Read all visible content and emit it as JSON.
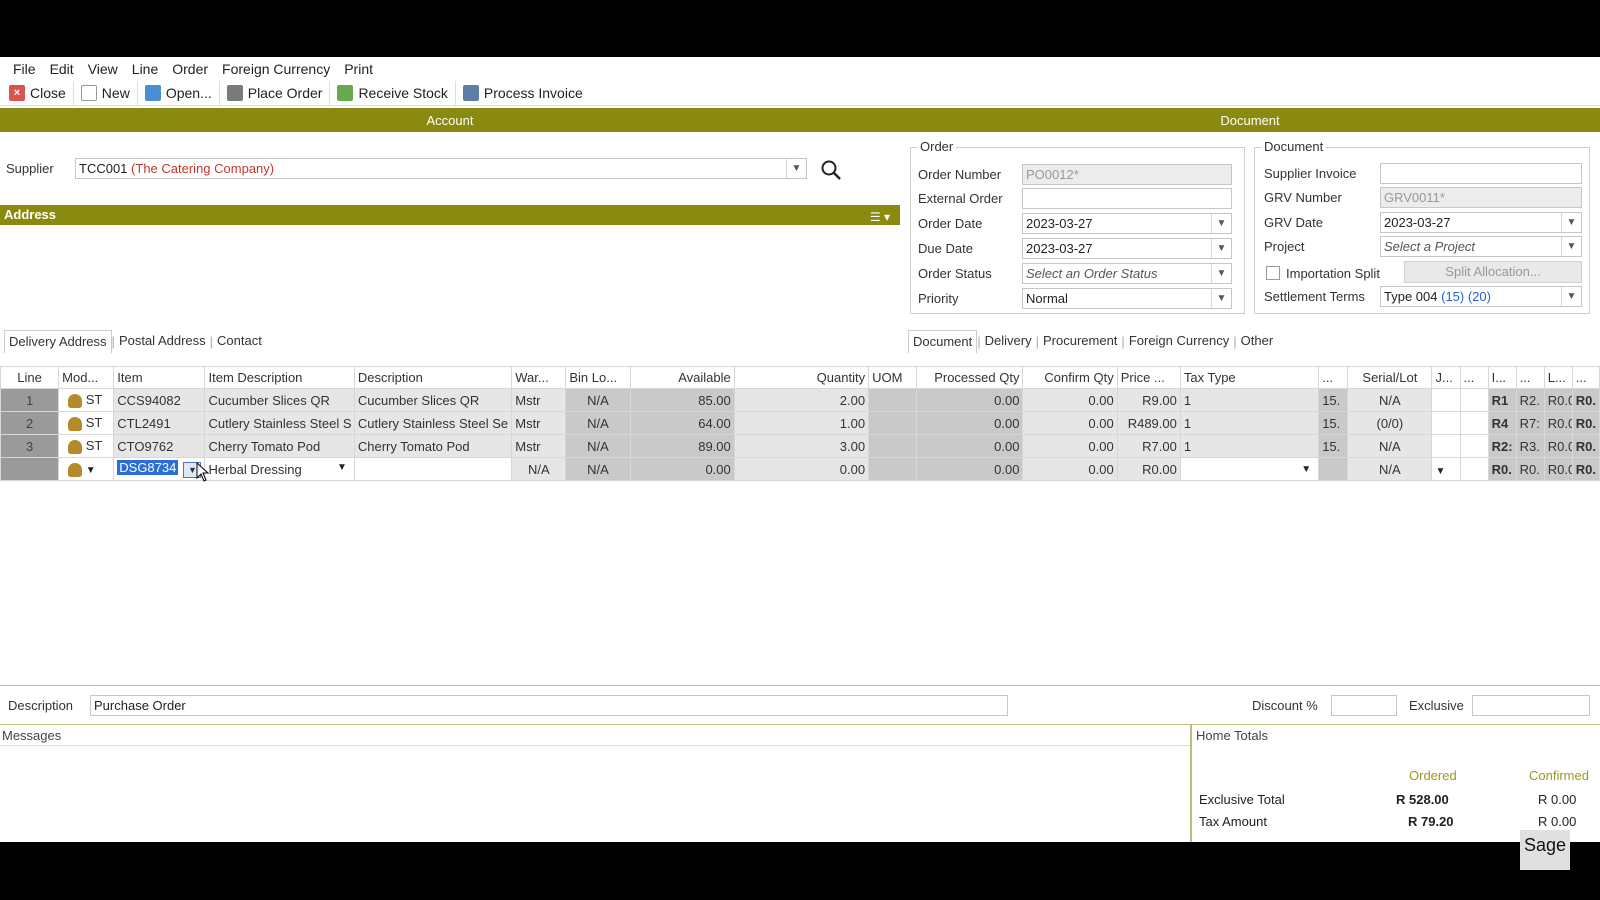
{
  "menu": [
    "File",
    "Edit",
    "View",
    "Line",
    "Order",
    "Foreign Currency",
    "Print"
  ],
  "toolbar": {
    "close": "Close",
    "new": "New",
    "open": "Open...",
    "place_order": "Place Order",
    "receive_stock": "Receive Stock",
    "process_invoice": "Process Invoice"
  },
  "sections": {
    "account": "Account",
    "document": "Document"
  },
  "supplier": {
    "label": "Supplier",
    "code": "TCC001",
    "name": "(The Catering Company)"
  },
  "address": {
    "title": "Address",
    "tabs": [
      "Delivery Address",
      "Postal Address",
      "Contact"
    ]
  },
  "order": {
    "title": "Order",
    "order_number_label": "Order Number",
    "order_number": "PO0012*",
    "external_order_label": "External Order",
    "external_order": "",
    "order_date_label": "Order Date",
    "order_date": "2023-03-27",
    "due_date_label": "Due Date",
    "due_date": "2023-03-27",
    "order_status_label": "Order Status",
    "order_status_placeholder": "Select an Order Status",
    "priority_label": "Priority",
    "priority": "Normal"
  },
  "document": {
    "title": "Document",
    "supplier_invoice_label": "Supplier Invoice",
    "supplier_invoice": "",
    "grv_number_label": "GRV Number",
    "grv_number": "GRV0011*",
    "grv_date_label": "GRV Date",
    "grv_date": "2023-03-27",
    "project_label": "Project",
    "project_placeholder": "Select a Project",
    "importation_split_label": "Importation Split",
    "split_allocation_label": "Split Allocation...",
    "settlement_terms_label": "Settlement Terms",
    "settlement_type": "Type 004",
    "settlement_days": "(15) (20)"
  },
  "doc_tabs": [
    "Document",
    "Delivery",
    "Procurement",
    "Foreign Currency",
    "Other"
  ],
  "grid": {
    "columns": [
      "Line",
      "Mod...",
      "Item",
      "Item Description",
      "Description",
      "War...",
      "Bin Lo...",
      "Available",
      "Quantity",
      "UOM",
      "Processed Qty",
      "Confirm Qty",
      "Price ...",
      "Tax Type",
      "...",
      "Serial/Lot",
      "J...",
      "...",
      "I...",
      "...",
      "L...",
      "..."
    ],
    "rows": [
      {
        "line": "1",
        "mod": "ST",
        "item": "CCS94082",
        "item_desc": "Cucumber Slices QR",
        "desc": "Cucumber Slices QR",
        "war": "Mstr",
        "bin": "N/A",
        "available": "85.00",
        "quantity": "2.00",
        "uom": "",
        "processed": "0.00",
        "confirm": "0.00",
        "price": "R9.00",
        "tax": "1",
        "c15": "15.",
        "serial": "N/A",
        "j": "",
        "d2": "",
        "i": "R1",
        "d3": "R2.",
        "l": "R0.0",
        "d4": "R0."
      },
      {
        "line": "2",
        "mod": "ST",
        "item": "CTL2491",
        "item_desc": "Cutlery Stainless Steel S",
        "desc": "Cutlery Stainless Steel Se",
        "war": "Mstr",
        "bin": "N/A",
        "available": "64.00",
        "quantity": "1.00",
        "uom": "",
        "processed": "0.00",
        "confirm": "0.00",
        "price": "R489.00",
        "tax": "1",
        "c15": "15.",
        "serial": "(0/0)",
        "j": "",
        "d2": "",
        "i": "R4",
        "d3": "R7:",
        "l": "R0.0",
        "d4": "R0."
      },
      {
        "line": "3",
        "mod": "ST",
        "item": "CTO9762",
        "item_desc": "Cherry Tomato Pod",
        "desc": "Cherry Tomato Pod",
        "war": "Mstr",
        "bin": "N/A",
        "available": "89.00",
        "quantity": "3.00",
        "uom": "",
        "processed": "0.00",
        "confirm": "0.00",
        "price": "R7.00",
        "tax": "1",
        "c15": "15.",
        "serial": "N/A",
        "j": "",
        "d2": "",
        "i": "R2:",
        "d3": "R3.",
        "l": "R0.0",
        "d4": "R0."
      }
    ],
    "edit_row": {
      "item": "DSG8734",
      "item_desc": "Herbal Dressing",
      "war": "N/A",
      "bin": "N/A",
      "available": "0.00",
      "quantity": "0.00",
      "processed": "0.00",
      "confirm": "0.00",
      "price": "R0.00",
      "serial": "N/A",
      "i": "R0.",
      "d3": "R0.",
      "l": "R0.0",
      "d4": "R0."
    }
  },
  "footer": {
    "description_label": "Description",
    "description": "Purchase Order",
    "discount_label": "Discount %",
    "exclusive_label": "Exclusive",
    "messages_label": "Messages",
    "home_totals_label": "Home Totals",
    "ordered_label": "Ordered",
    "confirmed_label": "Confirmed",
    "exclusive_total_label": "Exclusive Total",
    "exclusive_total_ordered": "R 528.00",
    "exclusive_total_confirmed": "R 0.00",
    "tax_amount_label": "Tax Amount",
    "tax_amount_ordered": "R 79.20",
    "tax_amount_confirmed": "R 0.00"
  },
  "brand": "Sage",
  "colors": {
    "section_bar": "#8a8a10",
    "supplier_name": "#c0392b",
    "settlement_days": "#2266cc",
    "selection": "#2c6ed6"
  }
}
